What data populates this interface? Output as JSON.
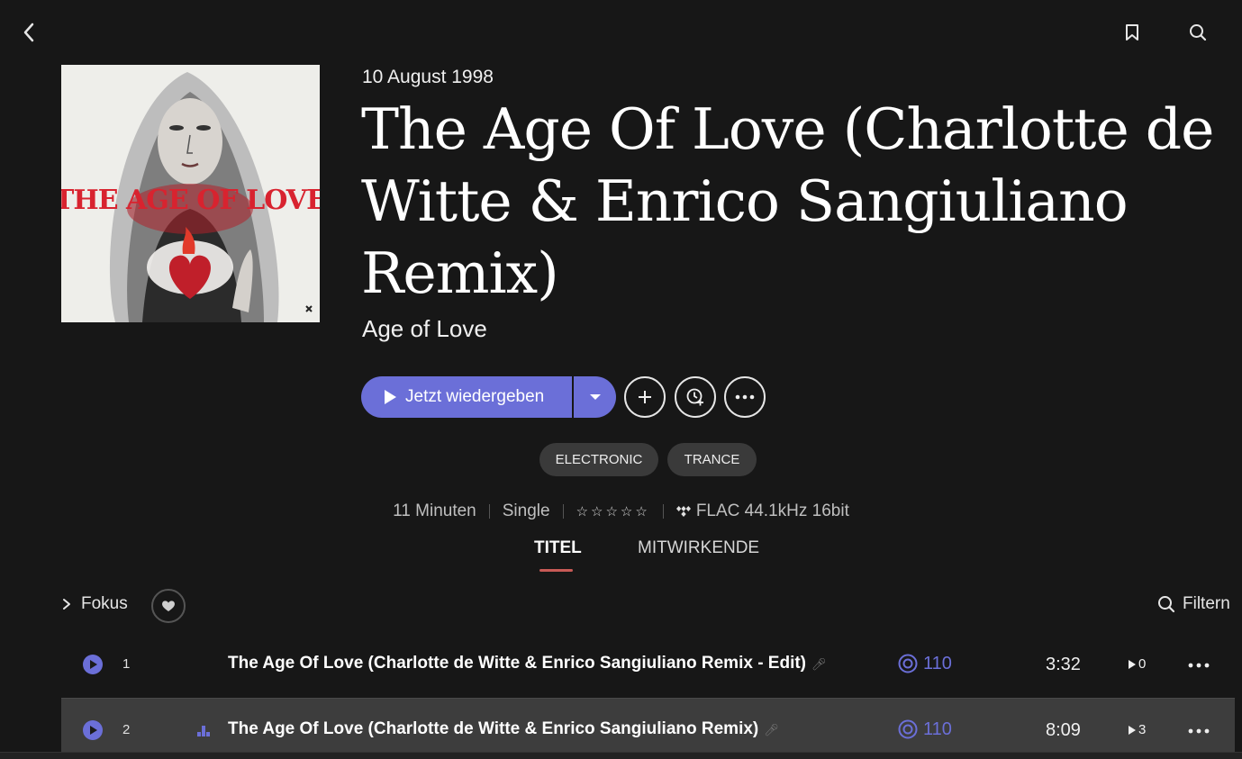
{
  "header": {
    "back_icon": "chevron-left-icon",
    "bookmark_icon": "bookmark-icon",
    "search_icon": "search-icon"
  },
  "album": {
    "date": "10 August 1998",
    "title": "The Age Of Love (Charlotte de Witte & Enrico Sangiuliano Remix)",
    "artist": "Age of Love",
    "cover_text": "THE AGE OF LOVE"
  },
  "actions": {
    "play_label": "Jetzt wiedergeben",
    "add_icon": "plus-icon",
    "history_icon": "clock-plus-icon",
    "more_icon": "ellipsis-icon"
  },
  "tags": [
    "ELECTRONIC",
    "TRANCE"
  ],
  "meta": {
    "duration": "11 Minuten",
    "type": "Single",
    "rating": "☆☆☆☆☆",
    "quality": "FLAC 44.1kHz 16bit"
  },
  "tabs": {
    "titel": "TITEL",
    "mitwirkende": "MITWIRKENDE",
    "active": "TITEL"
  },
  "toolbar": {
    "fokus": "Fokus",
    "filtern": "Filtern"
  },
  "tracks": [
    {
      "number": "1",
      "title": "The Age Of Love (Charlotte de Witte & Enrico Sangiuliano Remix - Edit)",
      "bpm": "110",
      "duration": "3:32",
      "plays": "0"
    },
    {
      "number": "2",
      "title": "The Age Of Love (Charlotte de Witte & Enrico Sangiuliano Remix)",
      "bpm": "110",
      "duration": "8:09",
      "plays": "3"
    }
  ],
  "colors": {
    "accent": "#6b6fd8",
    "background": "#171717",
    "tab_underline": "#c85a56"
  }
}
